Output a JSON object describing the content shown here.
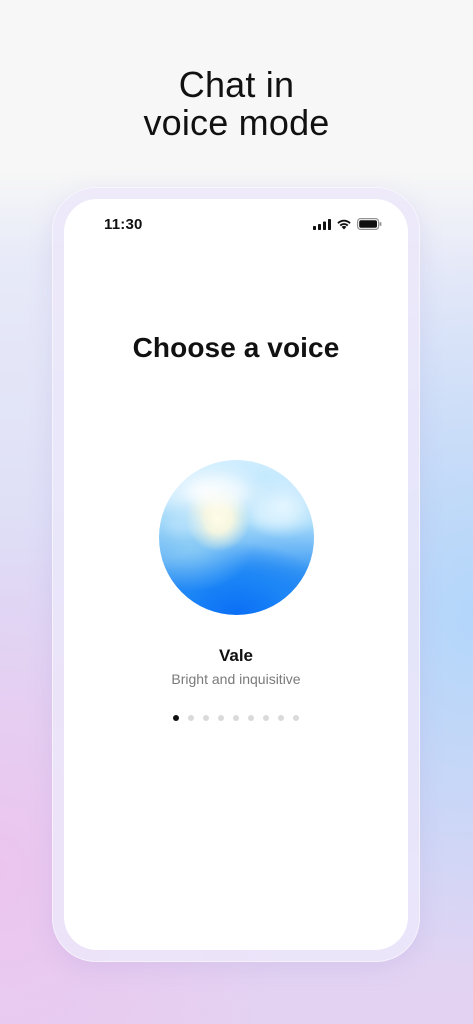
{
  "promo": {
    "title_line1": "Chat in",
    "title_line2": "voice mode"
  },
  "status_bar": {
    "time": "11:30",
    "icons": [
      "cellular-signal-icon",
      "wifi-icon",
      "battery-icon"
    ]
  },
  "screen": {
    "title": "Choose a voice"
  },
  "voice": {
    "name": "Vale",
    "description": "Bright and inquisitive"
  },
  "pager": {
    "count": 9,
    "active_index": 0
  },
  "colors": {
    "orb_primary": "#0b6cf3",
    "orb_highlight": "#fffae0",
    "active_dot": "#111111",
    "inactive_dot": "#dadada"
  }
}
